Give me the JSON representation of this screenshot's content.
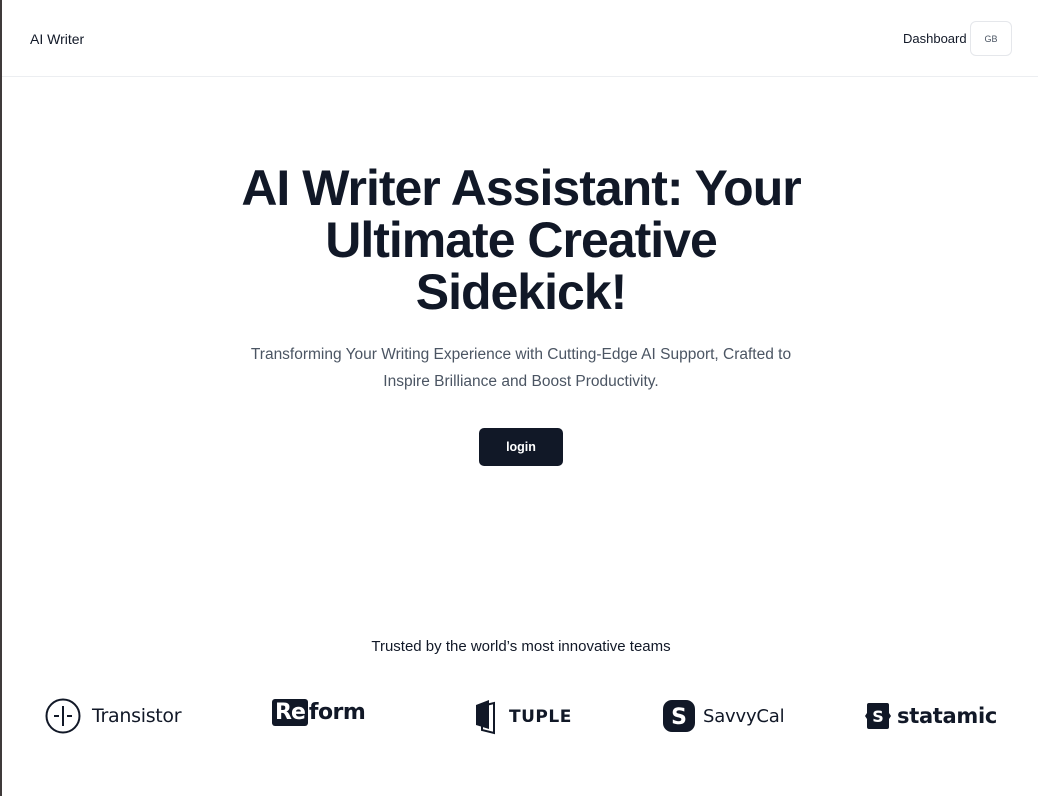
{
  "header": {
    "brand": "AI Writer",
    "nav_dashboard": "Dashboard",
    "avatar_initials": "GB"
  },
  "hero": {
    "title": "AI Writer Assistant: Your Ultimate Creative Sidekick!",
    "subtitle": "Transforming Your Writing Experience with Cutting-Edge AI Support, Crafted to Inspire Brilliance and Boost Productivity.",
    "login_label": "login"
  },
  "trusted": {
    "heading": "Trusted by the world’s most innovative teams",
    "logos": [
      {
        "name": "Transistor",
        "icon": "transistor-logo-icon"
      },
      {
        "name_part1": "Re",
        "name_part2": "form",
        "icon": "reform-logo"
      },
      {
        "name": "TUPLE",
        "icon": "tuple-logo-icon"
      },
      {
        "name": "SavvyCal",
        "icon": "savvycal-logo-icon"
      },
      {
        "name": "statamic",
        "icon": "statamic-logo-icon"
      }
    ]
  },
  "colors": {
    "text_dark": "#111827",
    "text_muted": "#4b5563",
    "button_bg": "#111827",
    "border": "#e5e7eb"
  }
}
